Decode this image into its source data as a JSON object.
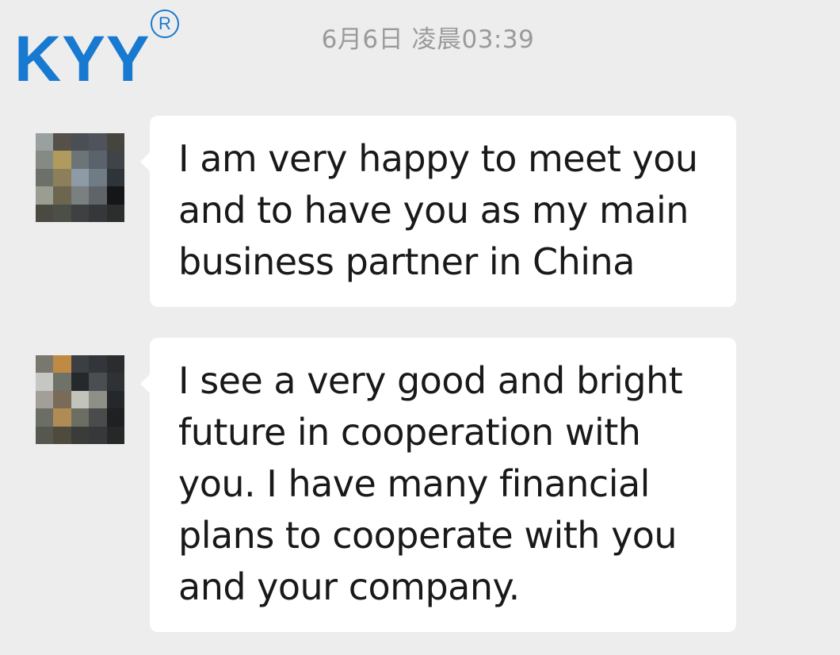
{
  "brand": {
    "name": "KYY",
    "registered_mark": "R",
    "color": "#1879d0"
  },
  "timestamp": "6月6日 凌晨03:39",
  "colors": {
    "background": "#ededed",
    "bubble": "#ffffff",
    "text": "#191919",
    "timestamp": "#9a9a9a"
  },
  "messages": [
    {
      "direction": "incoming",
      "avatar": "pixelated-avatar",
      "text": "I am very happy to meet you\nand to have you as my main\nbusiness partner in China"
    },
    {
      "direction": "incoming",
      "avatar": "pixelated-avatar",
      "text": "I see a very good and bright\nfuture in cooperation with\nyou. I have many financial\nplans to cooperate with you\nand your company."
    }
  ]
}
